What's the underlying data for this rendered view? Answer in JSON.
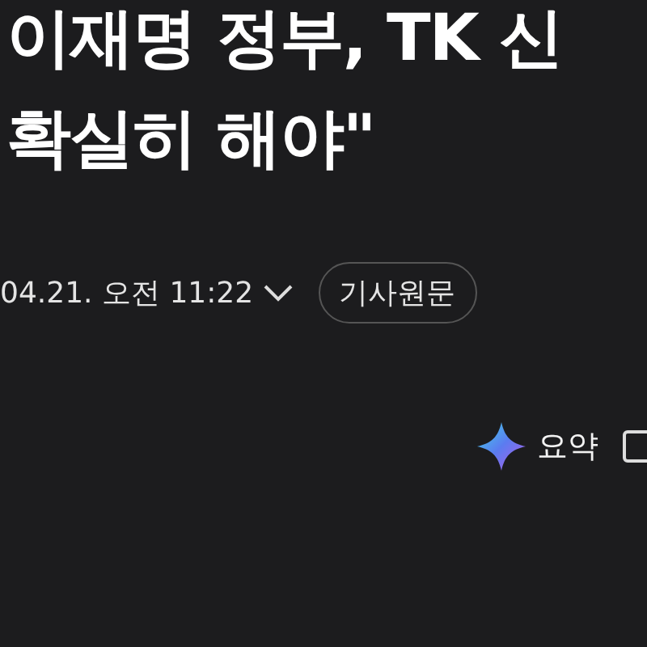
{
  "headline": {
    "lines": [
      "이재명 정부, TK 신",
      "확실히 해야\""
    ]
  },
  "meta": {
    "date": "04.21. 오전 11:22",
    "original_button": "기사원문"
  },
  "toolbar": {
    "summary_label": "요약"
  }
}
